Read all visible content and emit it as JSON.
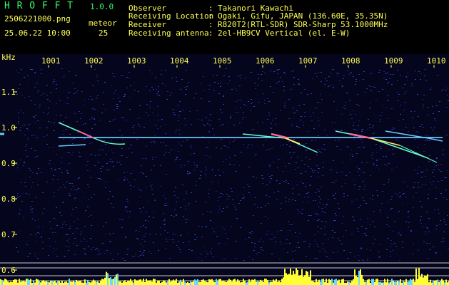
{
  "app": {
    "title": "H R O F F T",
    "version": "1.0.0"
  },
  "file": {
    "name": "2506221000.png",
    "timestamp": "25.06.22 10:00"
  },
  "meteor": {
    "label": "meteor",
    "count": "25"
  },
  "info": [
    {
      "label": "Observer",
      "sep": ":",
      "value": "Takanori Kawachi"
    },
    {
      "label": "Receiving Location",
      "sep": ":",
      "value": "Ogaki, Gifu, JAPAN (136.60E, 35.35N)"
    },
    {
      "label": "Receiver",
      "sep": ":",
      "value": "R820T2(RTL-SDR) SDR-Sharp 53.1000MHz"
    },
    {
      "label": "Receiving antenna",
      "sep": ":",
      "value": "2el-HB9CV Vertical (el. E-W)"
    }
  ],
  "axis": {
    "y_unit": "kHz",
    "time_ticks": [
      "1001",
      "1002",
      "1003",
      "1004",
      "1005",
      "1006",
      "1007",
      "1008",
      "1009",
      "1010"
    ],
    "freq_ticks": [
      "1.1",
      "1.0",
      "0.9",
      "0.8",
      "0.7",
      "0.6"
    ]
  },
  "colors": {
    "header_green": "#33ff66",
    "header_yellow": "#ffff55",
    "background_noise": "#1a1f7a",
    "carrier": "#66ccff",
    "echo_hot": "#ff6699",
    "echo_warm": "#ffee66",
    "meteor_bar": "#ffff33"
  }
}
